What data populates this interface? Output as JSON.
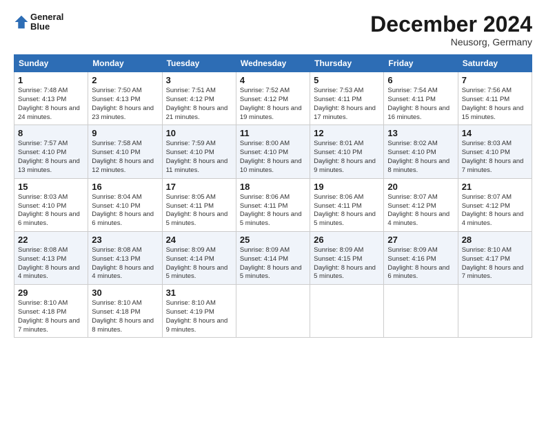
{
  "header": {
    "logo_line1": "General",
    "logo_line2": "Blue",
    "month": "December 2024",
    "location": "Neusorg, Germany"
  },
  "days_of_week": [
    "Sunday",
    "Monday",
    "Tuesday",
    "Wednesday",
    "Thursday",
    "Friday",
    "Saturday"
  ],
  "weeks": [
    [
      {
        "num": "1",
        "rise": "7:48 AM",
        "set": "4:13 PM",
        "daylight": "8 hours and 24 minutes."
      },
      {
        "num": "2",
        "rise": "7:50 AM",
        "set": "4:13 PM",
        "daylight": "8 hours and 23 minutes."
      },
      {
        "num": "3",
        "rise": "7:51 AM",
        "set": "4:12 PM",
        "daylight": "8 hours and 21 minutes."
      },
      {
        "num": "4",
        "rise": "7:52 AM",
        "set": "4:12 PM",
        "daylight": "8 hours and 19 minutes."
      },
      {
        "num": "5",
        "rise": "7:53 AM",
        "set": "4:11 PM",
        "daylight": "8 hours and 17 minutes."
      },
      {
        "num": "6",
        "rise": "7:54 AM",
        "set": "4:11 PM",
        "daylight": "8 hours and 16 minutes."
      },
      {
        "num": "7",
        "rise": "7:56 AM",
        "set": "4:11 PM",
        "daylight": "8 hours and 15 minutes."
      }
    ],
    [
      {
        "num": "8",
        "rise": "7:57 AM",
        "set": "4:10 PM",
        "daylight": "8 hours and 13 minutes."
      },
      {
        "num": "9",
        "rise": "7:58 AM",
        "set": "4:10 PM",
        "daylight": "8 hours and 12 minutes."
      },
      {
        "num": "10",
        "rise": "7:59 AM",
        "set": "4:10 PM",
        "daylight": "8 hours and 11 minutes."
      },
      {
        "num": "11",
        "rise": "8:00 AM",
        "set": "4:10 PM",
        "daylight": "8 hours and 10 minutes."
      },
      {
        "num": "12",
        "rise": "8:01 AM",
        "set": "4:10 PM",
        "daylight": "8 hours and 9 minutes."
      },
      {
        "num": "13",
        "rise": "8:02 AM",
        "set": "4:10 PM",
        "daylight": "8 hours and 8 minutes."
      },
      {
        "num": "14",
        "rise": "8:03 AM",
        "set": "4:10 PM",
        "daylight": "8 hours and 7 minutes."
      }
    ],
    [
      {
        "num": "15",
        "rise": "8:03 AM",
        "set": "4:10 PM",
        "daylight": "8 hours and 6 minutes."
      },
      {
        "num": "16",
        "rise": "8:04 AM",
        "set": "4:10 PM",
        "daylight": "8 hours and 6 minutes."
      },
      {
        "num": "17",
        "rise": "8:05 AM",
        "set": "4:11 PM",
        "daylight": "8 hours and 5 minutes."
      },
      {
        "num": "18",
        "rise": "8:06 AM",
        "set": "4:11 PM",
        "daylight": "8 hours and 5 minutes."
      },
      {
        "num": "19",
        "rise": "8:06 AM",
        "set": "4:11 PM",
        "daylight": "8 hours and 5 minutes."
      },
      {
        "num": "20",
        "rise": "8:07 AM",
        "set": "4:12 PM",
        "daylight": "8 hours and 4 minutes."
      },
      {
        "num": "21",
        "rise": "8:07 AM",
        "set": "4:12 PM",
        "daylight": "8 hours and 4 minutes."
      }
    ],
    [
      {
        "num": "22",
        "rise": "8:08 AM",
        "set": "4:13 PM",
        "daylight": "8 hours and 4 minutes."
      },
      {
        "num": "23",
        "rise": "8:08 AM",
        "set": "4:13 PM",
        "daylight": "8 hours and 4 minutes."
      },
      {
        "num": "24",
        "rise": "8:09 AM",
        "set": "4:14 PM",
        "daylight": "8 hours and 5 minutes."
      },
      {
        "num": "25",
        "rise": "8:09 AM",
        "set": "4:14 PM",
        "daylight": "8 hours and 5 minutes."
      },
      {
        "num": "26",
        "rise": "8:09 AM",
        "set": "4:15 PM",
        "daylight": "8 hours and 5 minutes."
      },
      {
        "num": "27",
        "rise": "8:09 AM",
        "set": "4:16 PM",
        "daylight": "8 hours and 6 minutes."
      },
      {
        "num": "28",
        "rise": "8:10 AM",
        "set": "4:17 PM",
        "daylight": "8 hours and 7 minutes."
      }
    ],
    [
      {
        "num": "29",
        "rise": "8:10 AM",
        "set": "4:18 PM",
        "daylight": "8 hours and 7 minutes."
      },
      {
        "num": "30",
        "rise": "8:10 AM",
        "set": "4:18 PM",
        "daylight": "8 hours and 8 minutes."
      },
      {
        "num": "31",
        "rise": "8:10 AM",
        "set": "4:19 PM",
        "daylight": "8 hours and 9 minutes."
      },
      null,
      null,
      null,
      null
    ]
  ]
}
